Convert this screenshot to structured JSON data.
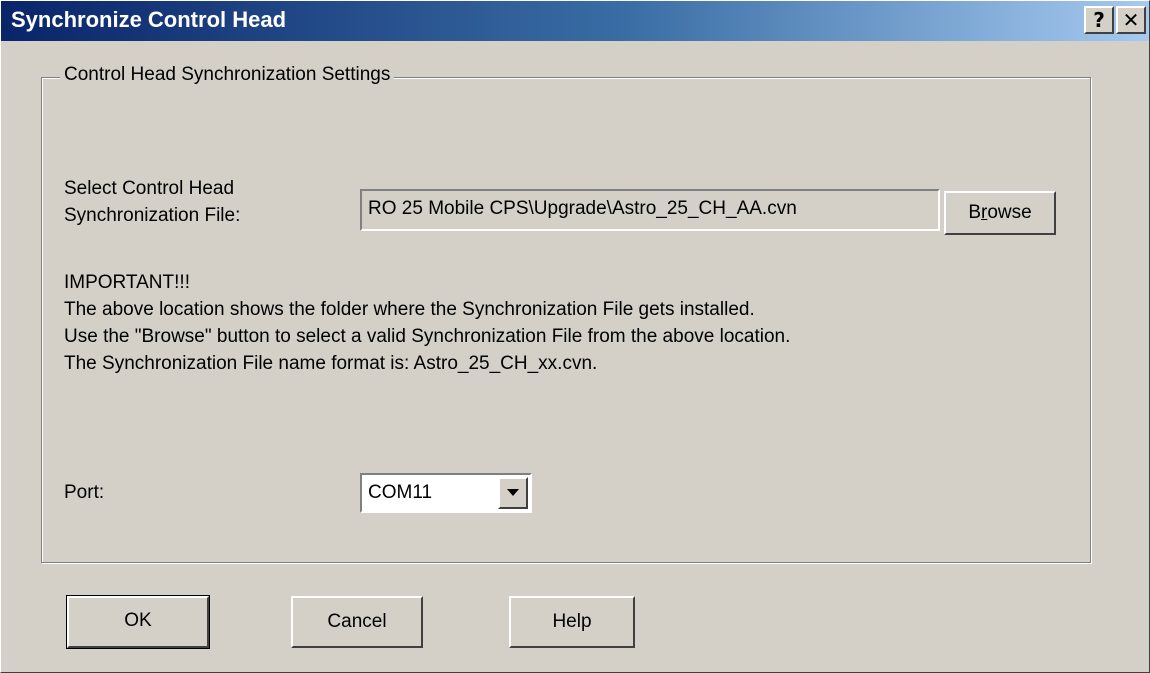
{
  "window": {
    "title": "Synchronize Control Head",
    "help_glyph": "?",
    "close_glyph": "✕"
  },
  "group": {
    "legend": "Control Head Synchronization Settings"
  },
  "file": {
    "label": "Select Control Head Synchronization File:",
    "value": "RO 25 Mobile CPS\\Upgrade\\Astro_25_CH_AA.cvn",
    "browse_label_pre": "B",
    "browse_label_mnemonic": "r",
    "browse_label_post": "owse"
  },
  "notice": {
    "heading": "IMPORTANT!!!",
    "line1": "The above location shows the folder where the Synchronization File gets installed.",
    "line2": "Use the \"Browse\" button to select a valid Synchronization File from the above location.",
    "line3": "The Synchronization File name format is: Astro_25_CH_xx.cvn."
  },
  "port": {
    "label": "Port:",
    "selected": "COM11"
  },
  "buttons": {
    "ok": "OK",
    "cancel": "Cancel",
    "help": "Help"
  },
  "colors": {
    "face": "#d4d0c8",
    "title_start": "#0a246a",
    "title_end": "#a6caf0"
  }
}
